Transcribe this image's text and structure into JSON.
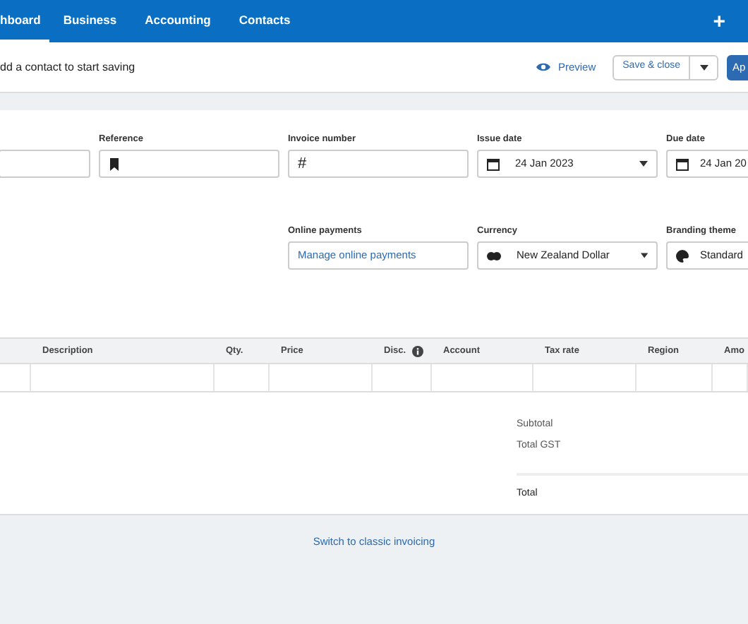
{
  "nav": {
    "tabs": [
      {
        "label": "hboard",
        "selected": true
      },
      {
        "label": "Business",
        "selected": false
      },
      {
        "label": "Accounting",
        "selected": false
      },
      {
        "label": "Contacts",
        "selected": false
      }
    ],
    "add": "+"
  },
  "toolbar": {
    "message": "dd a contact to start saving",
    "preview": "Preview",
    "save": "Save & close",
    "approve": "Ap"
  },
  "fields_row1": [
    {
      "kind": "plain"
    },
    {
      "kind": "plain",
      "label": "Reference"
    },
    {
      "kind": "plain",
      "label": "Invoice number",
      "prefix": "#"
    },
    {
      "kind": "select",
      "label": "Issue date",
      "value": "24 Jan 2023"
    },
    {
      "kind": "select",
      "label": "Due date",
      "value": "24 Jan 20"
    }
  ],
  "fields_row2": [
    {
      "kind": "link",
      "label": "Online payments",
      "value": "Manage online payments"
    },
    {
      "kind": "select",
      "label": "Currency",
      "value": "New Zealand Dollar"
    },
    {
      "kind": "select",
      "label": "Branding theme",
      "value": "Standard"
    }
  ],
  "table": {
    "columns": [
      "",
      "Description",
      "Qty.",
      "Price",
      "Disc.",
      "Account",
      "Tax rate",
      "Region",
      "Amo"
    ]
  },
  "totals": [
    "Subtotal",
    "Total GST",
    "Total"
  ],
  "footer_link": "Switch to classic invoicing"
}
